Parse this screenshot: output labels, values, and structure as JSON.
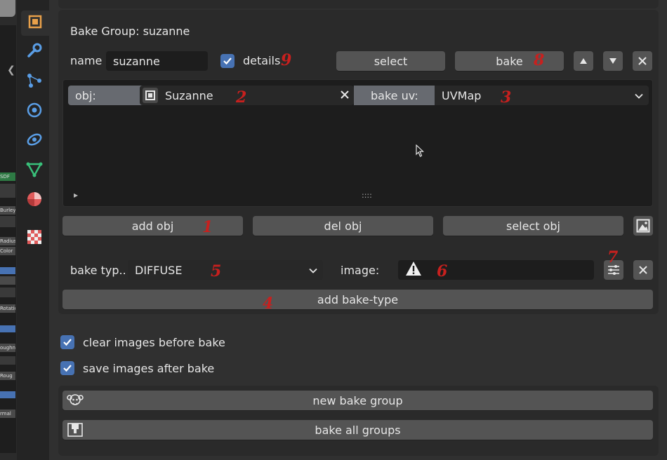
{
  "panel_title": "Bake Group: suzanne",
  "name_label": "name",
  "name_value": "suzanne",
  "details_label": "details",
  "select_button": "select",
  "bake_button": "bake",
  "obj_label": "obj:",
  "obj_value": "Suzanne",
  "bake_uv_label": "bake uv:",
  "bake_uv_value": "UVMap",
  "list_toggle": "▸",
  "list_grip": "::::",
  "add_obj_button": "add obj",
  "del_obj_button": "del obj",
  "select_obj_button": "select obj",
  "bake_type_label": "bake typ..",
  "bake_type_value": "DIFFUSE",
  "image_label": "image:",
  "add_bake_type_button": "add bake-type",
  "clear_images_label": "clear images before bake",
  "save_images_label": "save images after bake",
  "new_bake_group_button": "new bake group",
  "bake_all_groups_button": "bake all groups",
  "annotations": {
    "m1": "1",
    "m2": "2",
    "m3": "3",
    "m4": "4",
    "m5": "5",
    "m6": "6",
    "m7": "7",
    "m8": "8",
    "m9": "9"
  },
  "left_nodes": {
    "sdf": "SDF",
    "burley": "Burley",
    "radius": "Radius",
    "color": "Color",
    "rotation": "Rotatio",
    "roughness": "oughne",
    "rough2": "Roug",
    "normal": "rmal"
  },
  "colors": {
    "accent": "#4772b3",
    "button": "#545454",
    "field": "#1d1d1d",
    "panel": "#2a2a2a",
    "annotation": "#c8201e"
  },
  "icons": {
    "tabs": [
      "object-icon",
      "wrench-icon",
      "particles-icon",
      "physics-icon",
      "constraints-icon",
      "data-icon",
      "material-icon",
      "texture-icon"
    ]
  }
}
